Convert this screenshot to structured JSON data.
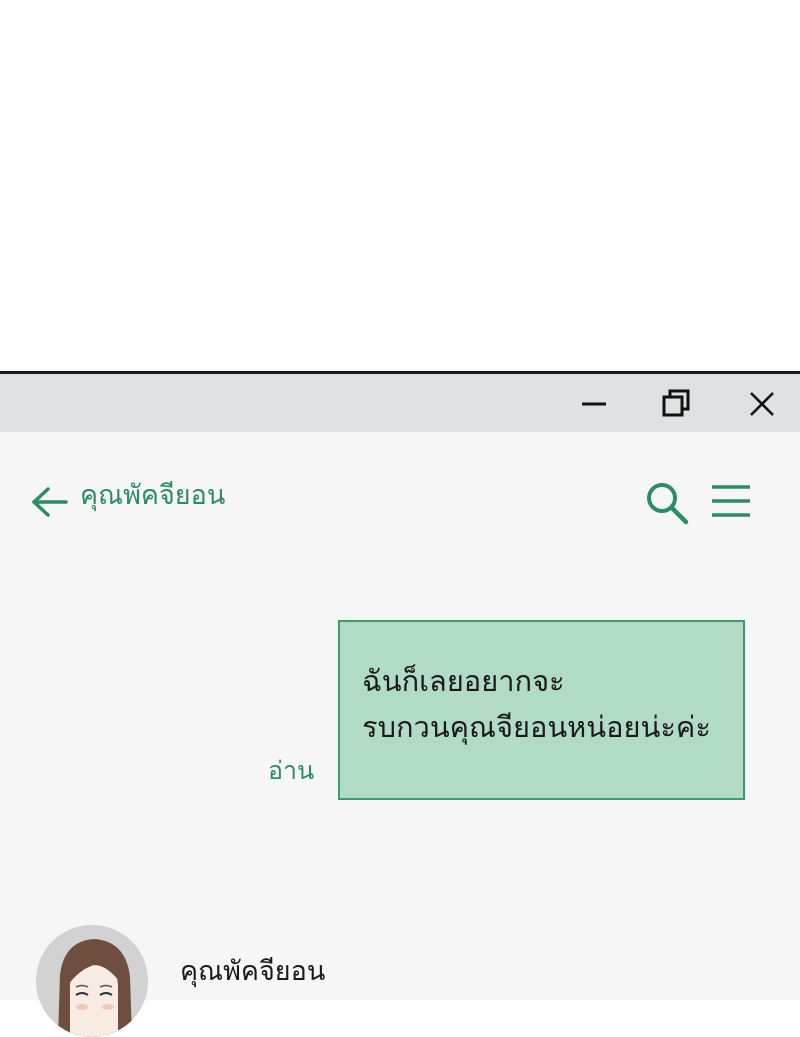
{
  "window": {
    "controls": {
      "minimize_icon": "minimize-icon",
      "restore_icon": "restore-icon",
      "close_icon": "close-icon"
    }
  },
  "header": {
    "contact_name": "คุณพัคจียอน",
    "back_icon": "arrow-left-icon",
    "search_icon": "search-icon",
    "menu_icon": "hamburger-menu-icon",
    "accent_color": "#2e8b63"
  },
  "messages": [
    {
      "direction": "outgoing",
      "lines": [
        "ฉันก็เลยอยากจะ",
        "รบกวนคุณจียอนหน่อยน่ะค่ะ"
      ],
      "status": "อ่าน",
      "bubble_color": "#b2dbc6"
    }
  ],
  "incoming": {
    "sender_name": "คุณพัคจียอน"
  }
}
